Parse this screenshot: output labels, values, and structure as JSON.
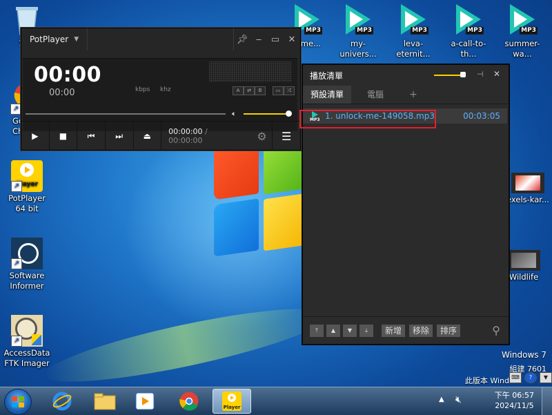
{
  "desktop": {
    "left_icons": [
      {
        "label": "資源",
        "icon": "recycle-bin-icon"
      },
      {
        "label": "Go",
        "label2": "Ch",
        "icon": "chrome-icon"
      },
      {
        "label": "PotPlayer 64 bit",
        "badge": "Player",
        "icon": "potplayer-icon"
      },
      {
        "label": "Software Informer",
        "icon": "software-informer-icon"
      },
      {
        "label": "AccessData FTK Imager",
        "icon": "ftk-imager-icon"
      }
    ],
    "top_files": [
      {
        "label": "k-me...",
        "badge": "MP3"
      },
      {
        "label": "my-univers...",
        "badge": "MP3"
      },
      {
        "label": "leva-eternit...",
        "badge": "MP3"
      },
      {
        "label": "a-call-to-th...",
        "badge": "MP3"
      },
      {
        "label": "summer-wa...",
        "badge": "MP3"
      }
    ],
    "right_icons": [
      {
        "label": "exels-kar...",
        "icon": "video-thumbnail-icon"
      },
      {
        "label": "Wildlife",
        "icon": "video-thumbnail-icon"
      }
    ],
    "watermark": {
      "line1": "Windows 7",
      "line2": "組建 7601",
      "line3": "此版本 Wind"
    }
  },
  "player": {
    "title": "PotPlayer",
    "time_big": "00:00",
    "time_small": "00:00",
    "kbps": "kbps",
    "khz": "khz",
    "mini_buttons": [
      "A",
      "⇄",
      "B"
    ],
    "elapsed": "00:00:00",
    "separator": "/",
    "total": "00:00:00",
    "volume_level": 0.9
  },
  "playlist": {
    "title": "播放清單",
    "tabs": [
      "預設清單",
      "電腦",
      "+"
    ],
    "items": [
      {
        "name": "1. unlock-me-149058.mp3",
        "duration": "00:03:05",
        "badge": "MP3"
      }
    ],
    "buttons": {
      "add": "新增",
      "remove": "移除",
      "sort": "排序"
    }
  },
  "taskbar": {
    "apps": [
      "start",
      "internet-explorer",
      "file-explorer",
      "media-player",
      "chrome",
      "potplayer"
    ],
    "potplayer_label": "Player",
    "clock_line1": "下午 06:57",
    "clock_line2": "2024/11/5"
  },
  "colors": {
    "accent_yellow": "#f7d300",
    "highlight_red": "#e4202c",
    "playlist_text": "#5ab4ff",
    "mp3_teal": "#22c6b3"
  }
}
